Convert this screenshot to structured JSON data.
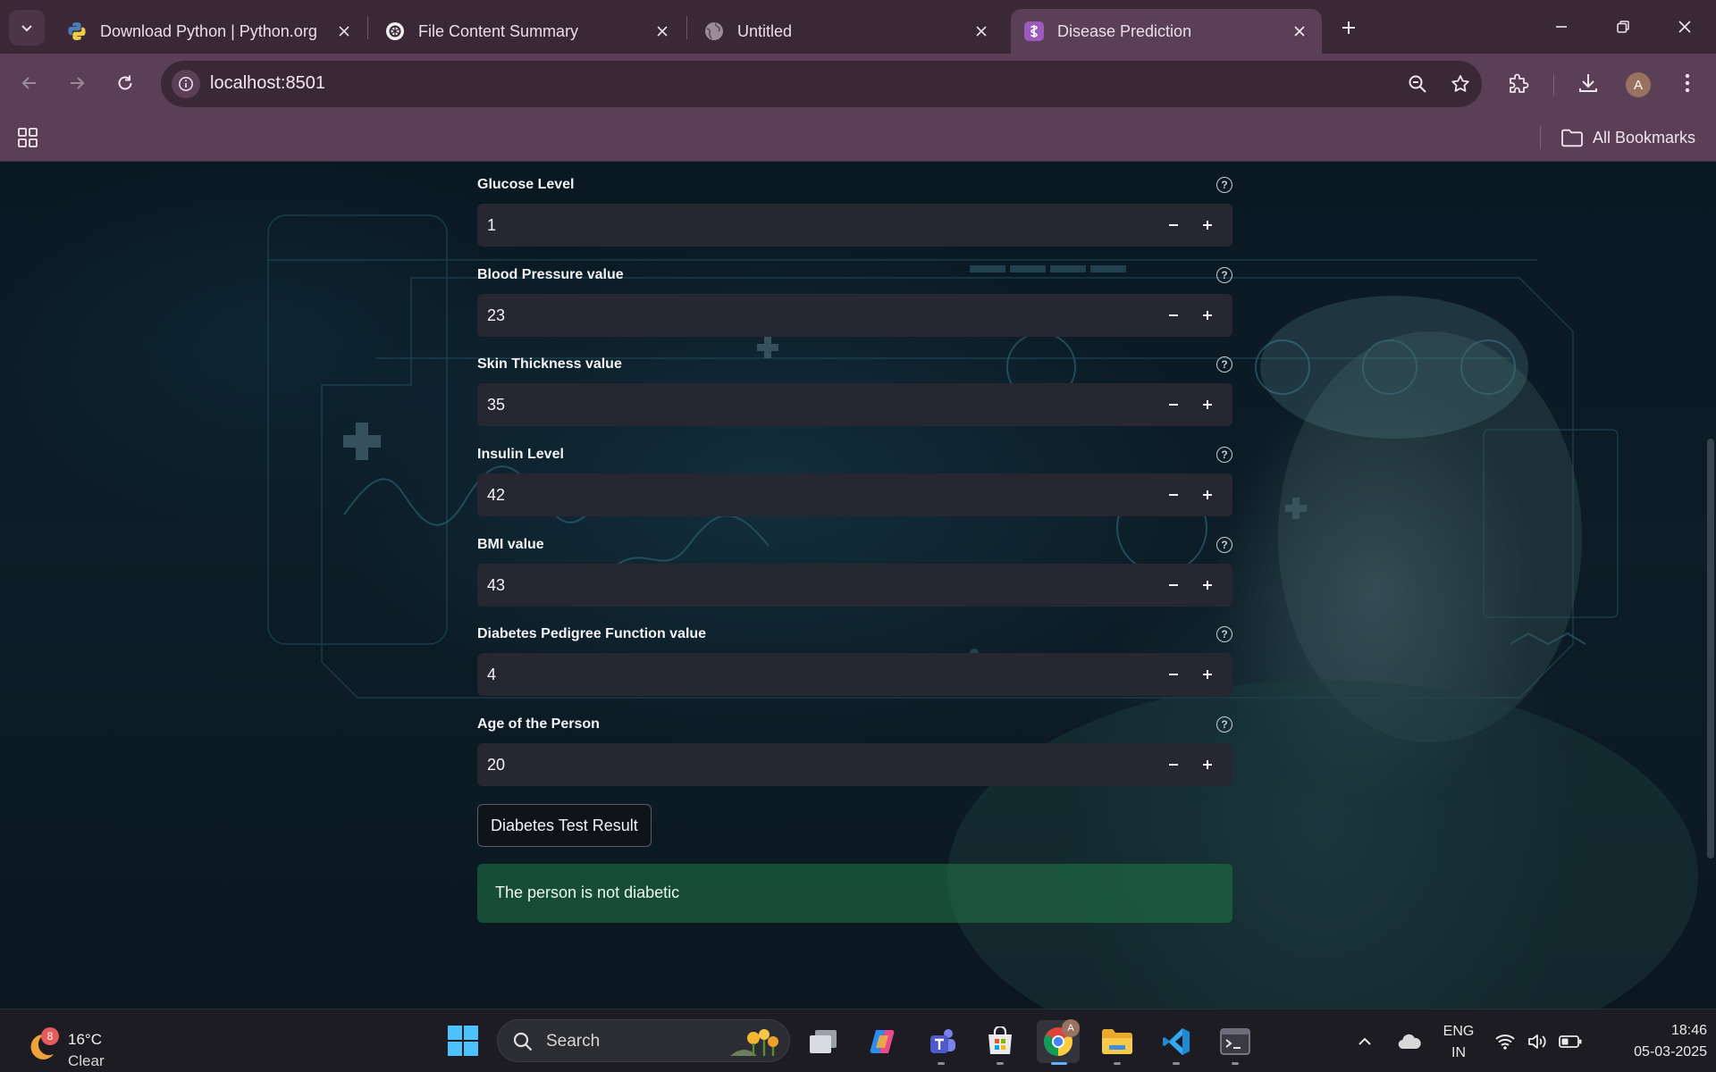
{
  "browser": {
    "tabs": [
      {
        "title": "Download Python | Python.org",
        "icon": "python-icon"
      },
      {
        "title": "File Content Summary",
        "icon": "openai-icon"
      },
      {
        "title": "Untitled",
        "icon": "globe-icon"
      },
      {
        "title": "Disease Prediction",
        "icon": "medical-icon",
        "active": true
      }
    ],
    "url": "localhost:8501",
    "profile_initial": "A",
    "bookmarks_label": "All Bookmarks"
  },
  "form": {
    "fields": [
      {
        "label": "Glucose Level",
        "value": "1"
      },
      {
        "label": "Blood Pressure value",
        "value": "23"
      },
      {
        "label": "Skin Thickness value",
        "value": "35"
      },
      {
        "label": "Insulin Level",
        "value": "42"
      },
      {
        "label": "BMI value",
        "value": "43"
      },
      {
        "label": "Diabetes Pedigree Function value",
        "value": "4"
      },
      {
        "label": "Age of the Person",
        "value": "20"
      }
    ],
    "help_glyph": "?",
    "submit_label": "Diabetes Test Result",
    "result_message": "The person is not diabetic"
  },
  "taskbar": {
    "weather": {
      "temp": "16°C",
      "condition": "Clear",
      "badge": "8"
    },
    "search_label": "Search",
    "language": {
      "line1": "ENG",
      "line2": "IN"
    },
    "time": "18:46",
    "date": "05-03-2025",
    "chrome_badge": "A"
  },
  "colors": {
    "chrome_frame": "#3a2837",
    "chrome_toolbar": "#5b3f57",
    "input_bg": "#262730",
    "success_bg": "#21784a",
    "taskbar_bg": "#1c1c22"
  }
}
